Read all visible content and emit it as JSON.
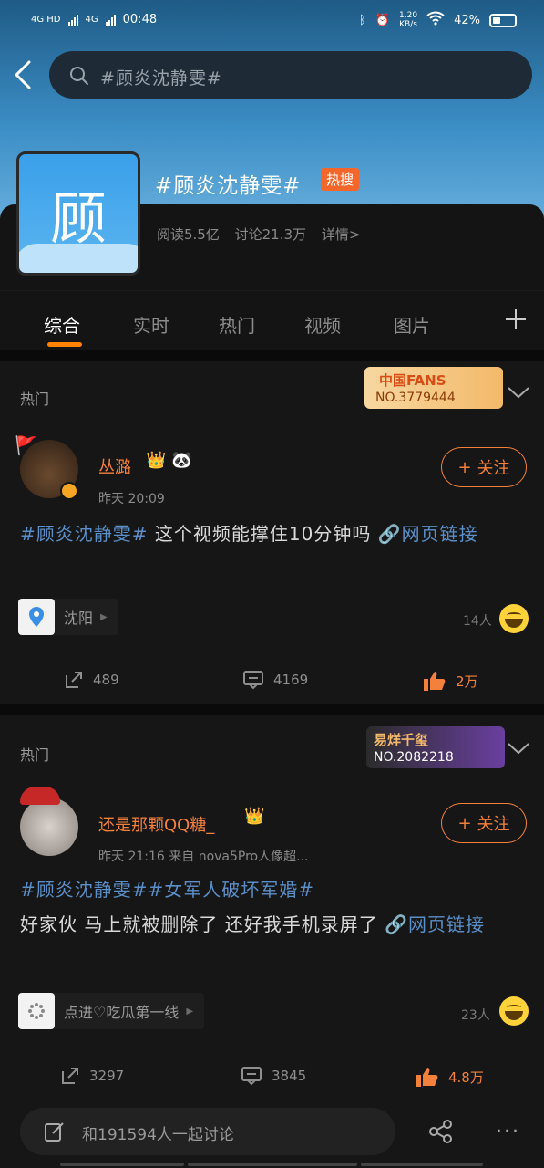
{
  "status_bar": {
    "network1": "4G HD",
    "network2": "4G",
    "time": "00:48",
    "speed": "1.20",
    "speed_unit": "KB/s",
    "battery": "42%"
  },
  "search": {
    "query": "#顾炎沈静雯#"
  },
  "topic": {
    "avatar_char": "顾",
    "title": "#顾炎沈静雯#",
    "badge": "热搜",
    "reads": "阅读5.5亿",
    "discussions": "讨论21.3万",
    "details": "详情>"
  },
  "tabs": [
    {
      "label": "综合"
    },
    {
      "label": "实时"
    },
    {
      "label": "热门"
    },
    {
      "label": "视频"
    },
    {
      "label": "图片"
    }
  ],
  "posts": [
    {
      "section": "热门",
      "fan_badge": {
        "title": "中国FANS",
        "number": "NO.3779444"
      },
      "user": "丛潞",
      "meta": "昨天 20:09",
      "follow": "关注",
      "tag": "#顾炎沈静雯#",
      "text": " 这个视频能撑住10分钟吗 ",
      "link": "网页链接",
      "chip": "沈阳",
      "people": "14人",
      "reposts": "489",
      "comments": "4169",
      "likes": "2万"
    },
    {
      "section": "热门",
      "fan_badge": {
        "title": "易烊千玺",
        "number": "NO.2082218"
      },
      "user": "还是那颗QQ糖_",
      "meta": "昨天 21:16  来自 nova5Pro人像超...",
      "follow": "关注",
      "tag": "#顾炎沈静雯##女军人破坏军婚#",
      "text": "好家伙 马上就被删除了 还好我手机录屏了 ",
      "link": "网页链接",
      "chip": "点进♡吃瓜第一线",
      "people": "23人",
      "reposts": "3297",
      "comments": "3845",
      "likes": "4.8万"
    }
  ],
  "bottom": {
    "placeholder": "和191594人一起讨论"
  },
  "colors": {
    "accent": "#f4813b",
    "tab_underline": "#ff8200",
    "hot_badge": "#f4662a",
    "link": "#5b8fc9"
  }
}
